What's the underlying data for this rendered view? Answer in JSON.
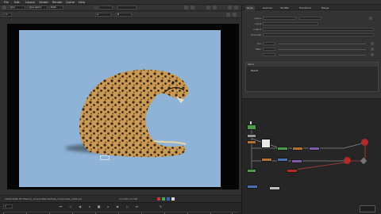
{
  "menubar": {
    "items": [
      "File",
      "Edit",
      "Layout",
      "Viewer",
      "Render",
      "Cache",
      "Help"
    ]
  },
  "viewer": {
    "toolbar1": {
      "channels": "rgba",
      "layer": "rgba.alpha",
      "view": "RGB"
    },
    "toolbar2": {
      "zoom": "1:1",
      "input_a": "A",
      "input_b": "B"
    },
    "format_label": "HD_1080",
    "status_info": "1920x1080 HD Beauty_LeopardRenderPass_Composite_v002.exr",
    "status_coords": "x=1163 y=748",
    "frame": "1",
    "timeline_ticks": [
      "1",
      "10",
      "20",
      "30",
      "40",
      "50",
      "60",
      "70",
      "80",
      "90",
      "100"
    ]
  },
  "properties": {
    "tabs": [
      "Node",
      "Gamma",
      "Shuffle",
      "Transform",
      "Merge"
    ],
    "fields": [
      "name",
      "input",
      "output",
      "channels",
      "mix",
      "filter"
    ],
    "list_header": "Stack",
    "list_item": "Read1"
  },
  "colors": {
    "image_bg": "#8eb3d6",
    "node_green": "#4c9a4c",
    "node_orange": "#b3712f",
    "node_purple": "#7f5aa6",
    "node_red": "#b02a2a",
    "node_blue": "#4d6fb0"
  }
}
